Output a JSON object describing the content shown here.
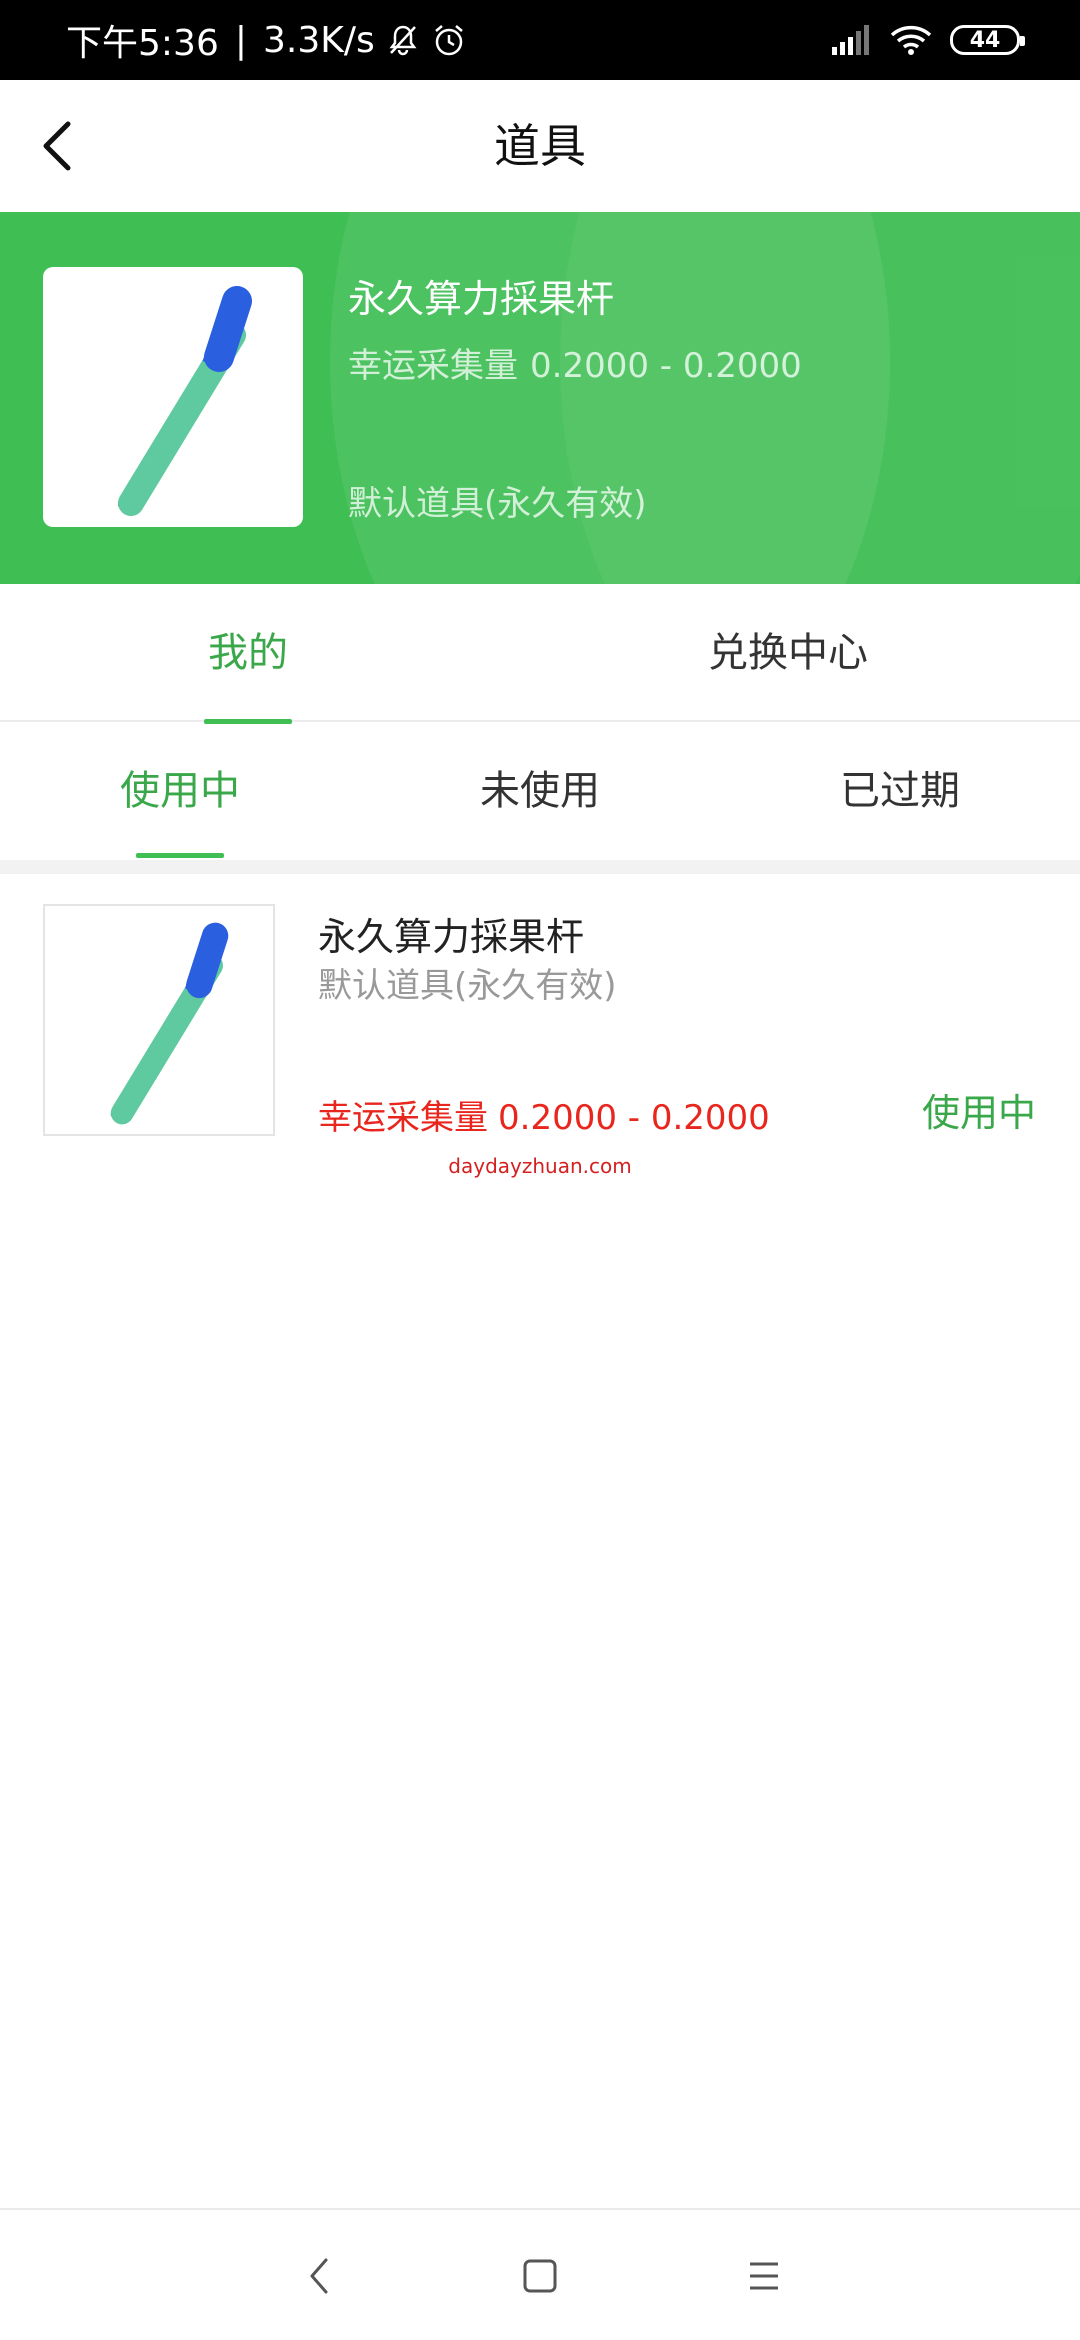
{
  "status_bar": {
    "time": "下午5:36",
    "separator": "|",
    "speed": "3.3K/s",
    "battery": "44",
    "icons": [
      "bell-off-icon",
      "alarm-icon",
      "signal-icon",
      "wifi-icon",
      "battery-icon"
    ]
  },
  "header": {
    "title": "道具",
    "back_icon": "chevron-left-icon"
  },
  "banner": {
    "name": "永久算力採果杆",
    "luck_label": "幸运采集量",
    "luck_value": "0.2000 - 0.2000",
    "default_label": "默认道具(永久有效)",
    "bg_color": "#3fbe54"
  },
  "main_tabs": [
    {
      "label": "我的",
      "active": true
    },
    {
      "label": "兑换中心",
      "active": false
    }
  ],
  "sub_tabs": [
    {
      "label": "使用中",
      "active": true
    },
    {
      "label": "未使用",
      "active": false
    },
    {
      "label": "已过期",
      "active": false
    }
  ],
  "items": [
    {
      "name": "永久算力採果杆",
      "default_label": "默认道具(永久有效)",
      "luck_label": "幸运采集量",
      "luck_value": "0.2000 - 0.2000",
      "status": "使用中"
    }
  ],
  "watermark": "daydayzhuan.com",
  "colors": {
    "accent": "#3aa84a",
    "luck": "#e8261d"
  },
  "bottom_nav": [
    "back-icon",
    "home-icon",
    "menu-icon"
  ]
}
